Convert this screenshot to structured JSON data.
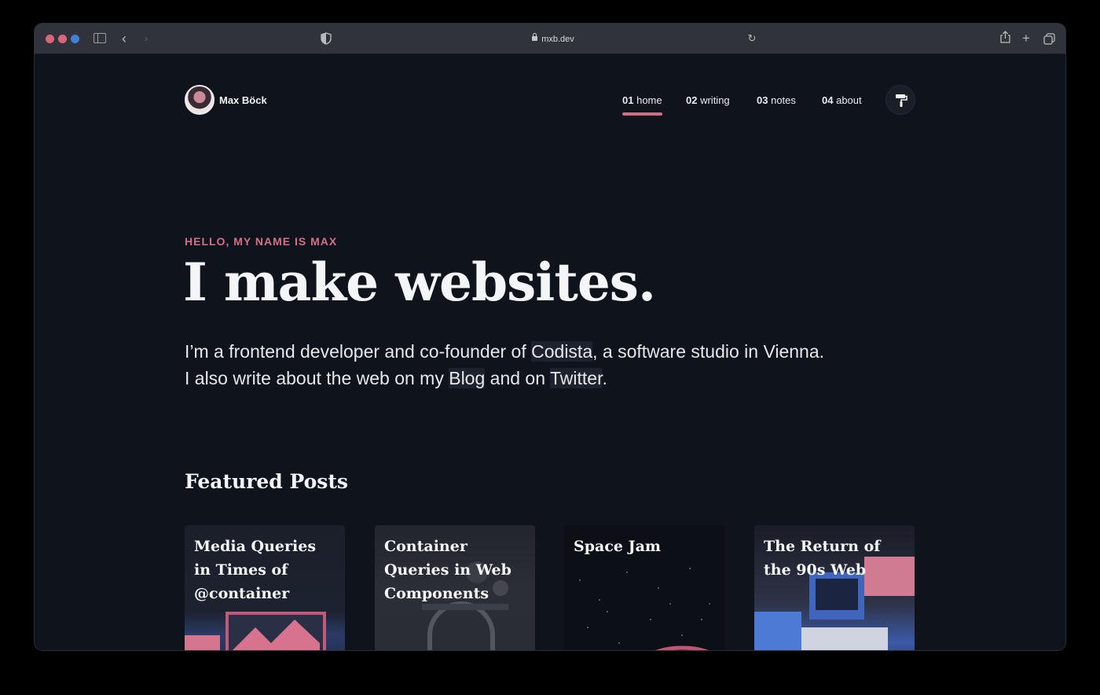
{
  "browser": {
    "url": "mxb.dev"
  },
  "header": {
    "site_name": "Max Böck",
    "nav": [
      {
        "num": "01",
        "label": "home"
      },
      {
        "num": "02",
        "label": "writing"
      },
      {
        "num": "03",
        "label": "notes"
      },
      {
        "num": "04",
        "label": "about"
      }
    ],
    "active_nav": "home"
  },
  "hero": {
    "kicker": "HELLO, MY NAME IS MAX",
    "title": "I make websites.",
    "intro_line1_prefix": "I’m a frontend developer and co-founder of ",
    "intro_link_codista": "Codista",
    "intro_line1_suffix": ", a software studio in Vienna.",
    "intro_line2_prefix": "I also write about the web on my ",
    "intro_link_blog": "Blog",
    "intro_line2_mid": " and on ",
    "intro_link_twitter": "Twitter",
    "intro_line2_suffix": "."
  },
  "featured": {
    "title": "Featured Posts",
    "posts": [
      {
        "title": "Media Queries in Times of @container"
      },
      {
        "title": "Container Queries in Web Components"
      },
      {
        "title": "Space Jam"
      },
      {
        "title": "The Return of the 90s Web"
      }
    ]
  },
  "colors": {
    "accent": "#d36b82",
    "background": "#0f131b",
    "text": "#f4f5f8"
  }
}
